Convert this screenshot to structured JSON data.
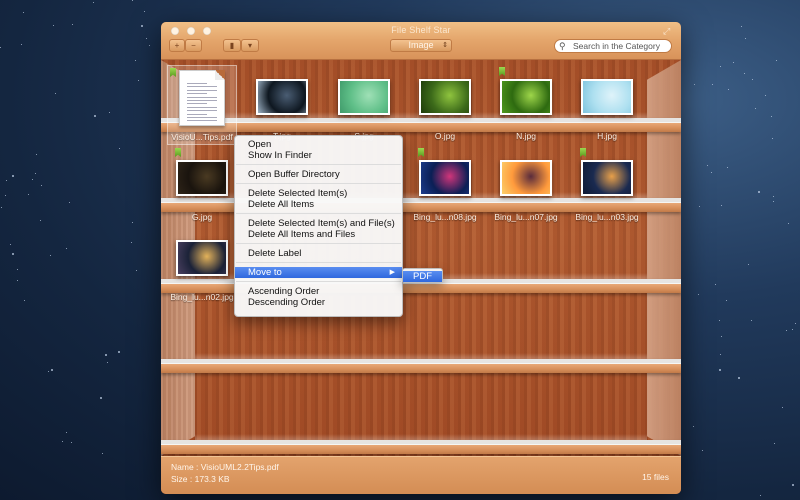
{
  "window": {
    "title": "File Shelf Star",
    "fullscreen_icon": "fullscreen-arrows-icon",
    "category_popup": "Image",
    "search_placeholder": "Search in the Category"
  },
  "toolbar": {
    "add_icon": "plus-icon",
    "remove_icon": "minus-icon",
    "tag_icon": "tag-icon",
    "label_icon": "label-dropdown-icon"
  },
  "shelves": [
    {
      "items": [
        {
          "label": "VisioU...Tips.pdf",
          "kind": "pdf",
          "bookmark": true,
          "selected": true
        },
        {
          "label": "T.jpg",
          "kind": "image",
          "colors": [
            "#0e1720",
            "#4a5d73",
            "#9fb4c7"
          ],
          "bookmark": false
        },
        {
          "label": "S.jpg",
          "kind": "image",
          "colors": [
            "#5fbf88",
            "#9fe0b6",
            "#3f9a6a"
          ],
          "bookmark": false
        },
        {
          "label": "O.jpg",
          "kind": "image",
          "colors": [
            "#3c6a1a",
            "#8fc43e",
            "#1d3b0a"
          ],
          "bookmark": false
        },
        {
          "label": "N.jpg",
          "kind": "image",
          "colors": [
            "#2e6a10",
            "#9ed64a",
            "#4f9a1e"
          ],
          "bookmark": true
        },
        {
          "label": "H.jpg",
          "kind": "image",
          "colors": [
            "#aee0f0",
            "#dff3fa",
            "#7ec4de"
          ],
          "bookmark": false
        }
      ]
    },
    {
      "items": [
        {
          "label": "G.jpg",
          "kind": "image",
          "colors": [
            "#1a140e",
            "#4a3a22",
            "#2e2418"
          ],
          "bookmark": true
        },
        {
          "label": "Bing_lu...n08.jpg",
          "kind": "image",
          "colors": [
            "#0b1f55",
            "#d0357a",
            "#1c3c8c"
          ],
          "bookmark": true
        },
        {
          "label": "Bing_lu...n07.jpg",
          "kind": "image",
          "colors": [
            "#ff9a3c",
            "#5a2c3c",
            "#fcd06a"
          ],
          "bookmark": false
        },
        {
          "label": "Bing_lu...n03.jpg",
          "kind": "image",
          "colors": [
            "#1a2a50",
            "#e8a04a",
            "#0f1a34"
          ],
          "bookmark": true
        }
      ]
    },
    {
      "items": [
        {
          "label": "Bing_lu...n02.jpg",
          "kind": "image",
          "colors": [
            "#1b2238",
            "#e3b25a",
            "#4a4060"
          ],
          "bookmark": false
        }
      ]
    }
  ],
  "context_menu": {
    "groups": [
      [
        "Open",
        "Show In Finder"
      ],
      [
        "Open Buffer Directory"
      ],
      [
        "Delete Selected Item(s)",
        "Delete All Items"
      ],
      [
        "Delete Selected Item(s) and File(s)",
        "Delete All Items and Files"
      ],
      [
        "Delete Label"
      ],
      [
        "Move to"
      ],
      [
        "Ascending Order",
        "Descending Order"
      ]
    ],
    "highlighted": "Move to",
    "submenu_arrow_icon": "triangle-right-icon",
    "submenu": [
      "PDF"
    ]
  },
  "status": {
    "name_label": "Name : ",
    "name_value": "VisioUML2.2Tips.pdf",
    "size_label": "Size   : ",
    "size_value": "173.3 KB",
    "count": "15 files"
  }
}
